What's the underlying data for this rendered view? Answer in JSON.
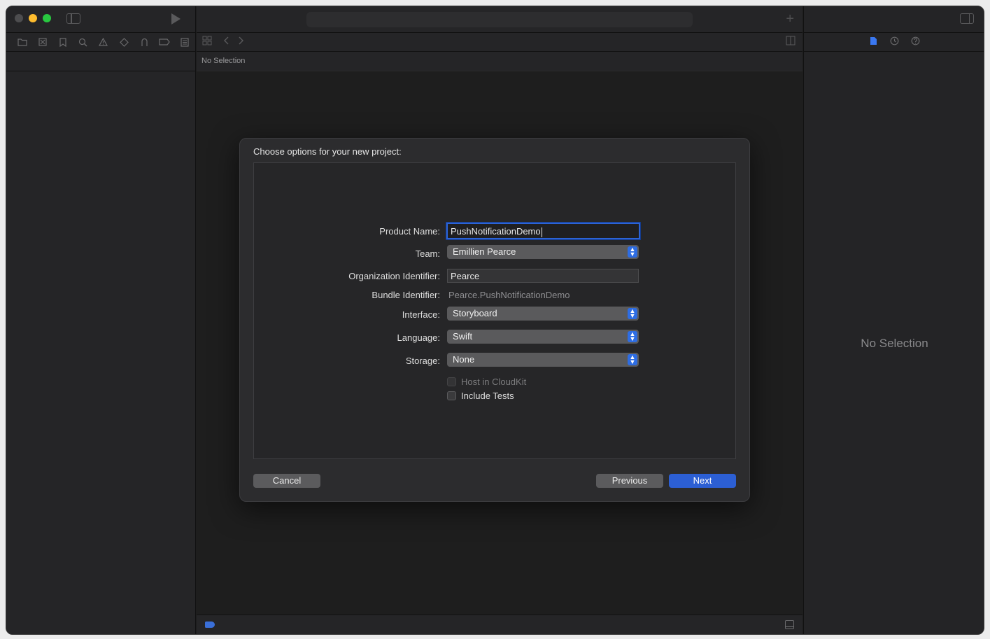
{
  "editor": {
    "path_text": "No Selection"
  },
  "inspector": {
    "empty_text": "No Selection"
  },
  "navigator": {
    "tabs": [
      "folder-icon",
      "source-control-icon",
      "bookmark-icon",
      "search-icon",
      "warning-icon",
      "test-icon",
      "debug-icon",
      "breakpoint-icon",
      "report-icon"
    ]
  },
  "sheet": {
    "title": "Choose options for your new project:",
    "fields": {
      "product_name": {
        "label": "Product Name:",
        "value": "PushNotificationDemo"
      },
      "team": {
        "label": "Team:",
        "value": "Emillien Pearce"
      },
      "organization_identifier": {
        "label": "Organization Identifier:",
        "value": "Pearce"
      },
      "bundle_identifier": {
        "label": "Bundle Identifier:",
        "value": "Pearce.PushNotificationDemo"
      },
      "interface": {
        "label": "Interface:",
        "value": "Storyboard"
      },
      "language": {
        "label": "Language:",
        "value": "Swift"
      },
      "storage": {
        "label": "Storage:",
        "value": "None"
      }
    },
    "checkboxes": {
      "host_in_cloudkit": {
        "label": "Host in CloudKit",
        "checked": false,
        "enabled": false
      },
      "include_tests": {
        "label": "Include Tests",
        "checked": false,
        "enabled": true
      }
    },
    "buttons": {
      "cancel": "Cancel",
      "previous": "Previous",
      "next": "Next"
    }
  },
  "colors": {
    "accent": "#2c5fd4",
    "window_bg": "#1e1e1e",
    "sheet_bg": "#2c2c2e"
  }
}
